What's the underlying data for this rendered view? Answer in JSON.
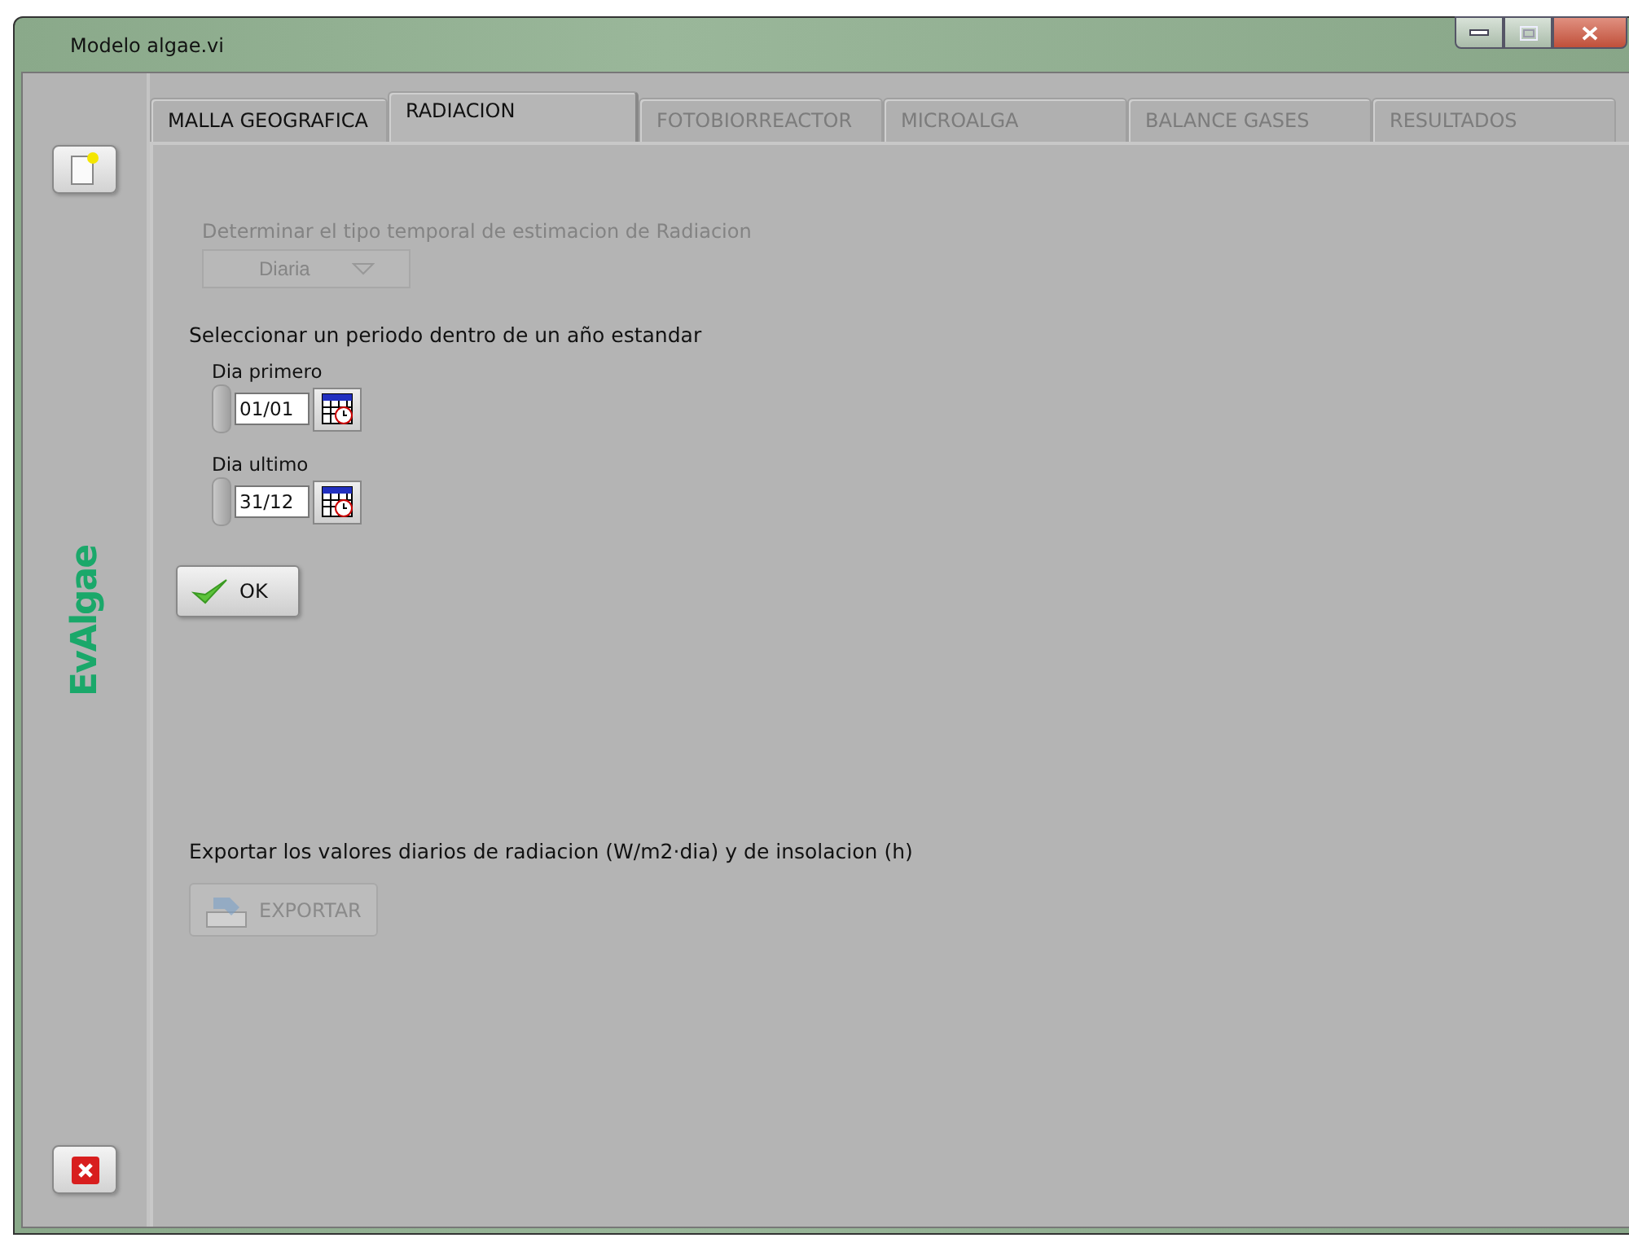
{
  "window": {
    "title": "Modelo algae.vi"
  },
  "sidebar": {
    "logo": "EvAlgae"
  },
  "tabs": [
    {
      "label": "MALLA GEOGRAFICA",
      "selected": false,
      "disabled": false
    },
    {
      "label": "RADIACION",
      "selected": true,
      "disabled": false
    },
    {
      "label": "FOTOBIORREACTOR",
      "selected": false,
      "disabled": true
    },
    {
      "label": "MICROALGA",
      "selected": false,
      "disabled": true
    },
    {
      "label": "BALANCE GASES",
      "selected": false,
      "disabled": true
    },
    {
      "label": "RESULTADOS",
      "selected": false,
      "disabled": true
    }
  ],
  "radiation_type": {
    "label": "Determinar el tipo temporal de estimacion de Radiacion",
    "value": "Diaria",
    "disabled": true
  },
  "period": {
    "heading": "Seleccionar un periodo dentro de un año estandar",
    "fields": [
      {
        "label": "Dia primero",
        "value": "01/01"
      },
      {
        "label": "Dia ultimo",
        "value": "31/12"
      }
    ]
  },
  "ok_button": {
    "label": "OK",
    "disabled": false
  },
  "export": {
    "heading": "Exportar los valores diarios de radiacion (W/m2·dia) y de insolacion (h)",
    "button": {
      "label": "EXPORTAR",
      "disabled": true
    }
  }
}
